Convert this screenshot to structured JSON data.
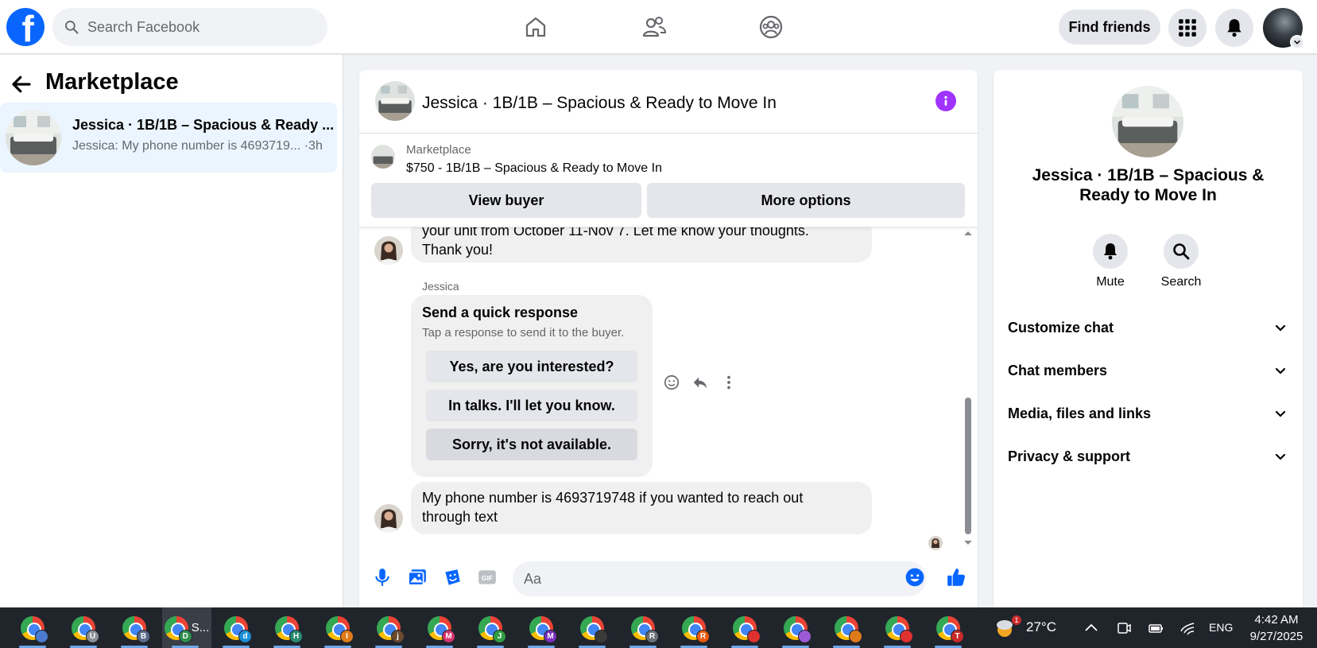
{
  "topbar": {
    "logo_letter": "f",
    "search_placeholder": "Search Facebook",
    "find_friends_label": "Find friends"
  },
  "sidebar": {
    "title": "Marketplace",
    "conversation": {
      "name": "Jessica · 1B/1B – Spacious & Ready ...",
      "preview": "Jessica: My phone number is 4693719... ·3h"
    }
  },
  "chat": {
    "title": "Jessica · 1B/1B – Spacious & Ready to Move In",
    "banner": {
      "label": "Marketplace",
      "listing": "$750 - 1B/1B – Spacious & Ready to Move In",
      "view_buyer": "View buyer",
      "more_options": "More options"
    },
    "messages": {
      "partial_line": "your unit from October 11-Nov 7. Let me know your thoughts.",
      "partial_line2": "Thank you!",
      "sender": "Jessica",
      "quick_title": "Send a quick response",
      "quick_sub": "Tap a response to send it to the buyer.",
      "quick_options": [
        "Yes, are you interested?",
        "In talks. I'll let you know.",
        "Sorry, it's not available."
      ],
      "last_message_line1": "My phone number is 4693719748 if you wanted to reach out",
      "last_message_line2": "through text"
    },
    "composer_placeholder": "Aa",
    "accent_color": "#0866ff",
    "info_color": "#a033ff"
  },
  "info_panel": {
    "name": "Jessica · 1B/1B – Spacious & Ready to Move In",
    "actions": [
      {
        "label": "Mute",
        "icon": "bell-icon"
      },
      {
        "label": "Search",
        "icon": "search-icon"
      }
    ],
    "sections": [
      "Customize chat",
      "Chat members",
      "Media, files and links",
      "Privacy & support"
    ]
  },
  "taskbar": {
    "apps": [
      {
        "badge": "",
        "badge_color": "#4a7bd0",
        "label": ""
      },
      {
        "badge": "U",
        "badge_color": "#8a8f96",
        "label": ""
      },
      {
        "badge": "B",
        "badge_color": "#5b6b8a",
        "label": ""
      },
      {
        "badge": "D",
        "badge_color": "#2f8f4e",
        "label": "S..."
      },
      {
        "badge": "d",
        "badge_color": "#1a8fd6",
        "label": ""
      },
      {
        "badge": "H",
        "badge_color": "#2a8a6e",
        "label": ""
      },
      {
        "badge": "I",
        "badge_color": "#e07b1a",
        "label": ""
      },
      {
        "badge": "j",
        "badge_color": "#6b4a2e",
        "label": ""
      },
      {
        "badge": "M",
        "badge_color": "#d6336c",
        "label": ""
      },
      {
        "badge": "J",
        "badge_color": "#2f9e44",
        "label": ""
      },
      {
        "badge": "M",
        "badge_color": "#7b2fbf",
        "label": ""
      },
      {
        "badge": "",
        "badge_color": "#3a3a3a",
        "label": ""
      },
      {
        "badge": "R",
        "badge_color": "#6b6f76",
        "label": ""
      },
      {
        "badge": "R",
        "badge_color": "#e8590c",
        "label": ""
      },
      {
        "badge": "",
        "badge_color": "#e03131",
        "label": ""
      },
      {
        "badge": "",
        "badge_color": "#9c5bd6",
        "label": ""
      },
      {
        "badge": "",
        "badge_color": "#e07b1a",
        "label": ""
      },
      {
        "badge": "",
        "badge_color": "#e03131",
        "label": ""
      },
      {
        "badge": "T",
        "badge_color": "#c92a2a",
        "label": ""
      }
    ],
    "weather_badge": "1",
    "temperature": "27°C",
    "language": "ENG",
    "time": "4:42 AM",
    "date": "9/27/2025"
  }
}
